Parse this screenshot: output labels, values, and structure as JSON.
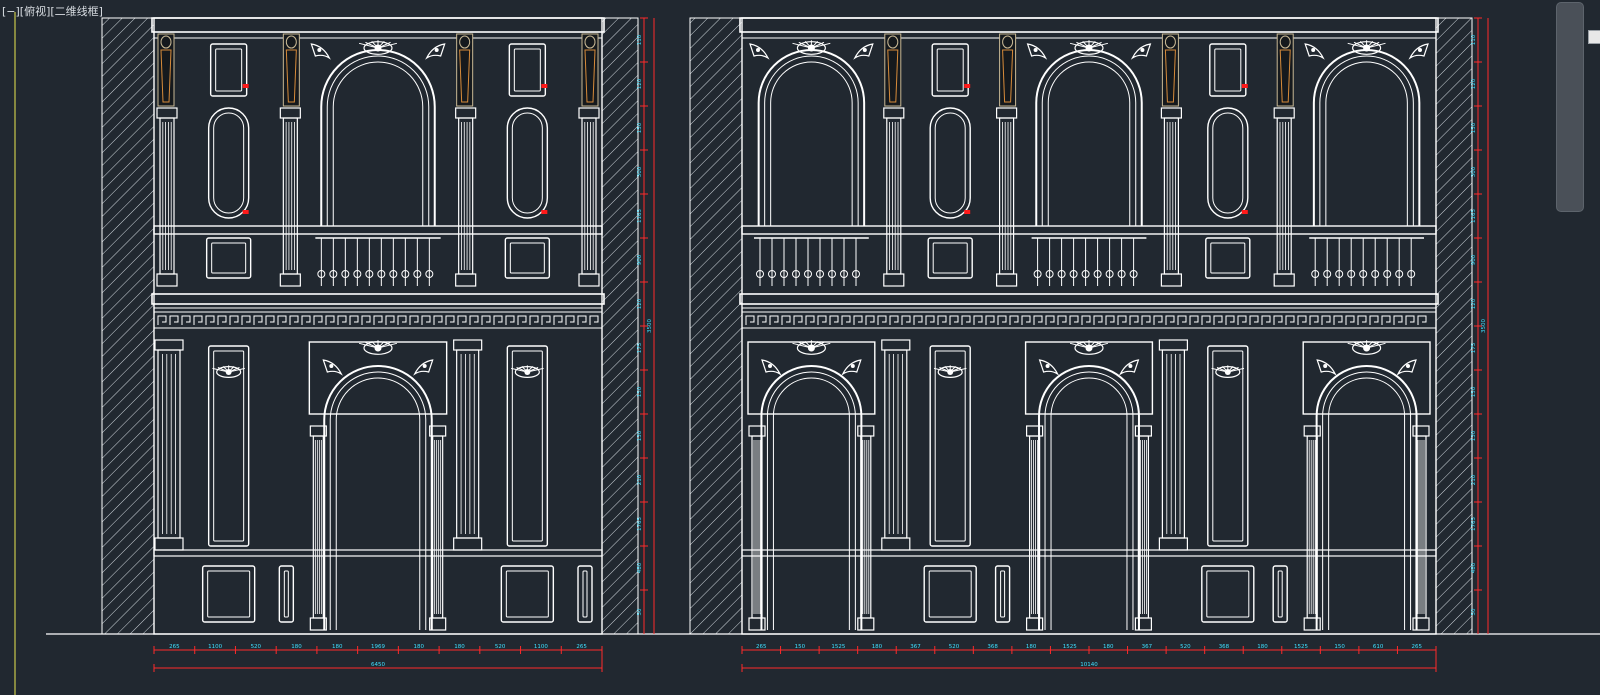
{
  "viewport": {
    "label": "[−][俯视][二维线框]"
  },
  "colors": {
    "background": "#212830",
    "linework": "#ffffff",
    "dimension": "#ff2a2a",
    "dimension_text": "#3fe0ff",
    "ornament": "#c8b894",
    "marker": "#ff1a1a",
    "hatch": "#cfd6dc"
  },
  "left_elevation": {
    "bottom_dims": [
      "265",
      "1100",
      "520",
      "180",
      "180",
      "1969",
      "180",
      "180",
      "520",
      "1100",
      "265"
    ],
    "total_width": "6450",
    "side_dims": [
      "110",
      "120",
      "150",
      "300",
      "1165",
      "900",
      "120",
      "175",
      "150",
      "130",
      "210",
      "1765",
      "480",
      "50"
    ],
    "total_height": "3500"
  },
  "right_elevation": {
    "bottom_dims": [
      "265",
      "150",
      "1525",
      "180",
      "367",
      "520",
      "368",
      "180",
      "1525",
      "180",
      "367",
      "520",
      "368",
      "180",
      "1525",
      "150",
      "610",
      "265"
    ],
    "total_width": "10140",
    "side_dims": [
      "110",
      "120",
      "150",
      "300",
      "1165",
      "900",
      "120",
      "175",
      "150",
      "130",
      "210",
      "1765",
      "480",
      "50"
    ],
    "total_height": "3500"
  },
  "icons": {
    "scrollbar": "vertical-scrollbar",
    "viewcube": "viewcube-icon"
  }
}
